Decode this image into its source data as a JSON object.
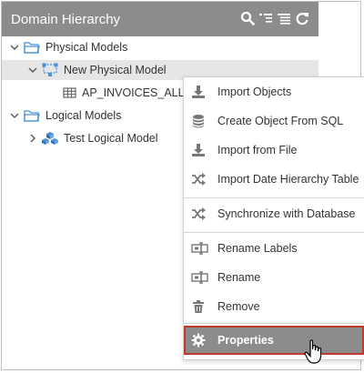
{
  "panel": {
    "title": "Domain Hierarchy",
    "tools": [
      "search-icon",
      "collapse-icon",
      "list-icon",
      "refresh-icon"
    ]
  },
  "tree": [
    {
      "label": "Physical Models",
      "icon": "folder-icon",
      "expanded": true
    },
    {
      "label": "New Physical Model",
      "icon": "physical-model-icon",
      "expanded": true,
      "selected": true
    },
    {
      "label": "AP_INVOICES_ALL",
      "icon": "table-icon"
    },
    {
      "label": "Logical Models",
      "icon": "folder-icon",
      "expanded": true
    },
    {
      "label": "Test Logical Model",
      "icon": "logical-model-icon",
      "expanded": false
    }
  ],
  "menu": {
    "items": [
      {
        "label": "Import Objects",
        "icon": "download-icon"
      },
      {
        "label": "Create Object From SQL",
        "icon": "database-icon"
      },
      {
        "label": "Import from File",
        "icon": "download-icon"
      },
      {
        "label": "Import Date Hierarchy Table",
        "icon": "shuffle-icon"
      },
      {
        "label": "Synchronize with Database",
        "icon": "shuffle-icon"
      },
      {
        "label": "Rename Labels",
        "icon": "rename-icon"
      },
      {
        "label": "Rename",
        "icon": "rename-icon"
      },
      {
        "label": "Remove",
        "icon": "trash-icon"
      },
      {
        "label": "Properties",
        "icon": "gear-icon",
        "highlighted": true
      }
    ]
  },
  "colors": {
    "header_bg": "#8c8c8c",
    "highlight_border": "#c0392b",
    "folder": "#4a90d9",
    "icon_gray": "#666666"
  }
}
